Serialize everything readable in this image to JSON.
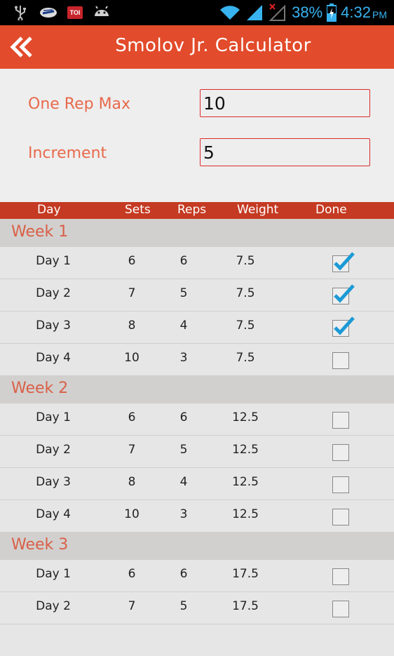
{
  "status_bar": {
    "battery": "38%",
    "time": "4:32",
    "ampm": "PM",
    "left_icons": [
      "usb-icon",
      "sync-icon",
      "toi-icon",
      "android-icon"
    ],
    "toi_label": "TOI"
  },
  "app_bar": {
    "title": "Smolov Jr. Calculator"
  },
  "form": {
    "one_rep_max_label": "One Rep Max",
    "one_rep_max_value": "10",
    "increment_label": "Increment",
    "increment_value": "5"
  },
  "table": {
    "columns": [
      "Day",
      "Sets",
      "Reps",
      "Weight",
      "Done"
    ],
    "weeks": [
      {
        "title": "Week 1",
        "rows": [
          {
            "day": "Day 1",
            "sets": "6",
            "reps": "6",
            "weight": "7.5",
            "done": true
          },
          {
            "day": "Day 2",
            "sets": "7",
            "reps": "5",
            "weight": "7.5",
            "done": true
          },
          {
            "day": "Day 3",
            "sets": "8",
            "reps": "4",
            "weight": "7.5",
            "done": true
          },
          {
            "day": "Day 4",
            "sets": "10",
            "reps": "3",
            "weight": "7.5",
            "done": false
          }
        ]
      },
      {
        "title": "Week 2",
        "rows": [
          {
            "day": "Day 1",
            "sets": "6",
            "reps": "6",
            "weight": "12.5",
            "done": false
          },
          {
            "day": "Day 2",
            "sets": "7",
            "reps": "5",
            "weight": "12.5",
            "done": false
          },
          {
            "day": "Day 3",
            "sets": "8",
            "reps": "4",
            "weight": "12.5",
            "done": false
          },
          {
            "day": "Day 4",
            "sets": "10",
            "reps": "3",
            "weight": "12.5",
            "done": false
          }
        ]
      },
      {
        "title": "Week 3",
        "rows": [
          {
            "day": "Day 1",
            "sets": "6",
            "reps": "6",
            "weight": "17.5",
            "done": false
          },
          {
            "day": "Day 2",
            "sets": "7",
            "reps": "5",
            "weight": "17.5",
            "done": false
          }
        ]
      }
    ]
  },
  "colors": {
    "accent": "#e24b2b",
    "header": "#c53a22",
    "label": "#e8694c",
    "check": "#1b9ad6"
  }
}
